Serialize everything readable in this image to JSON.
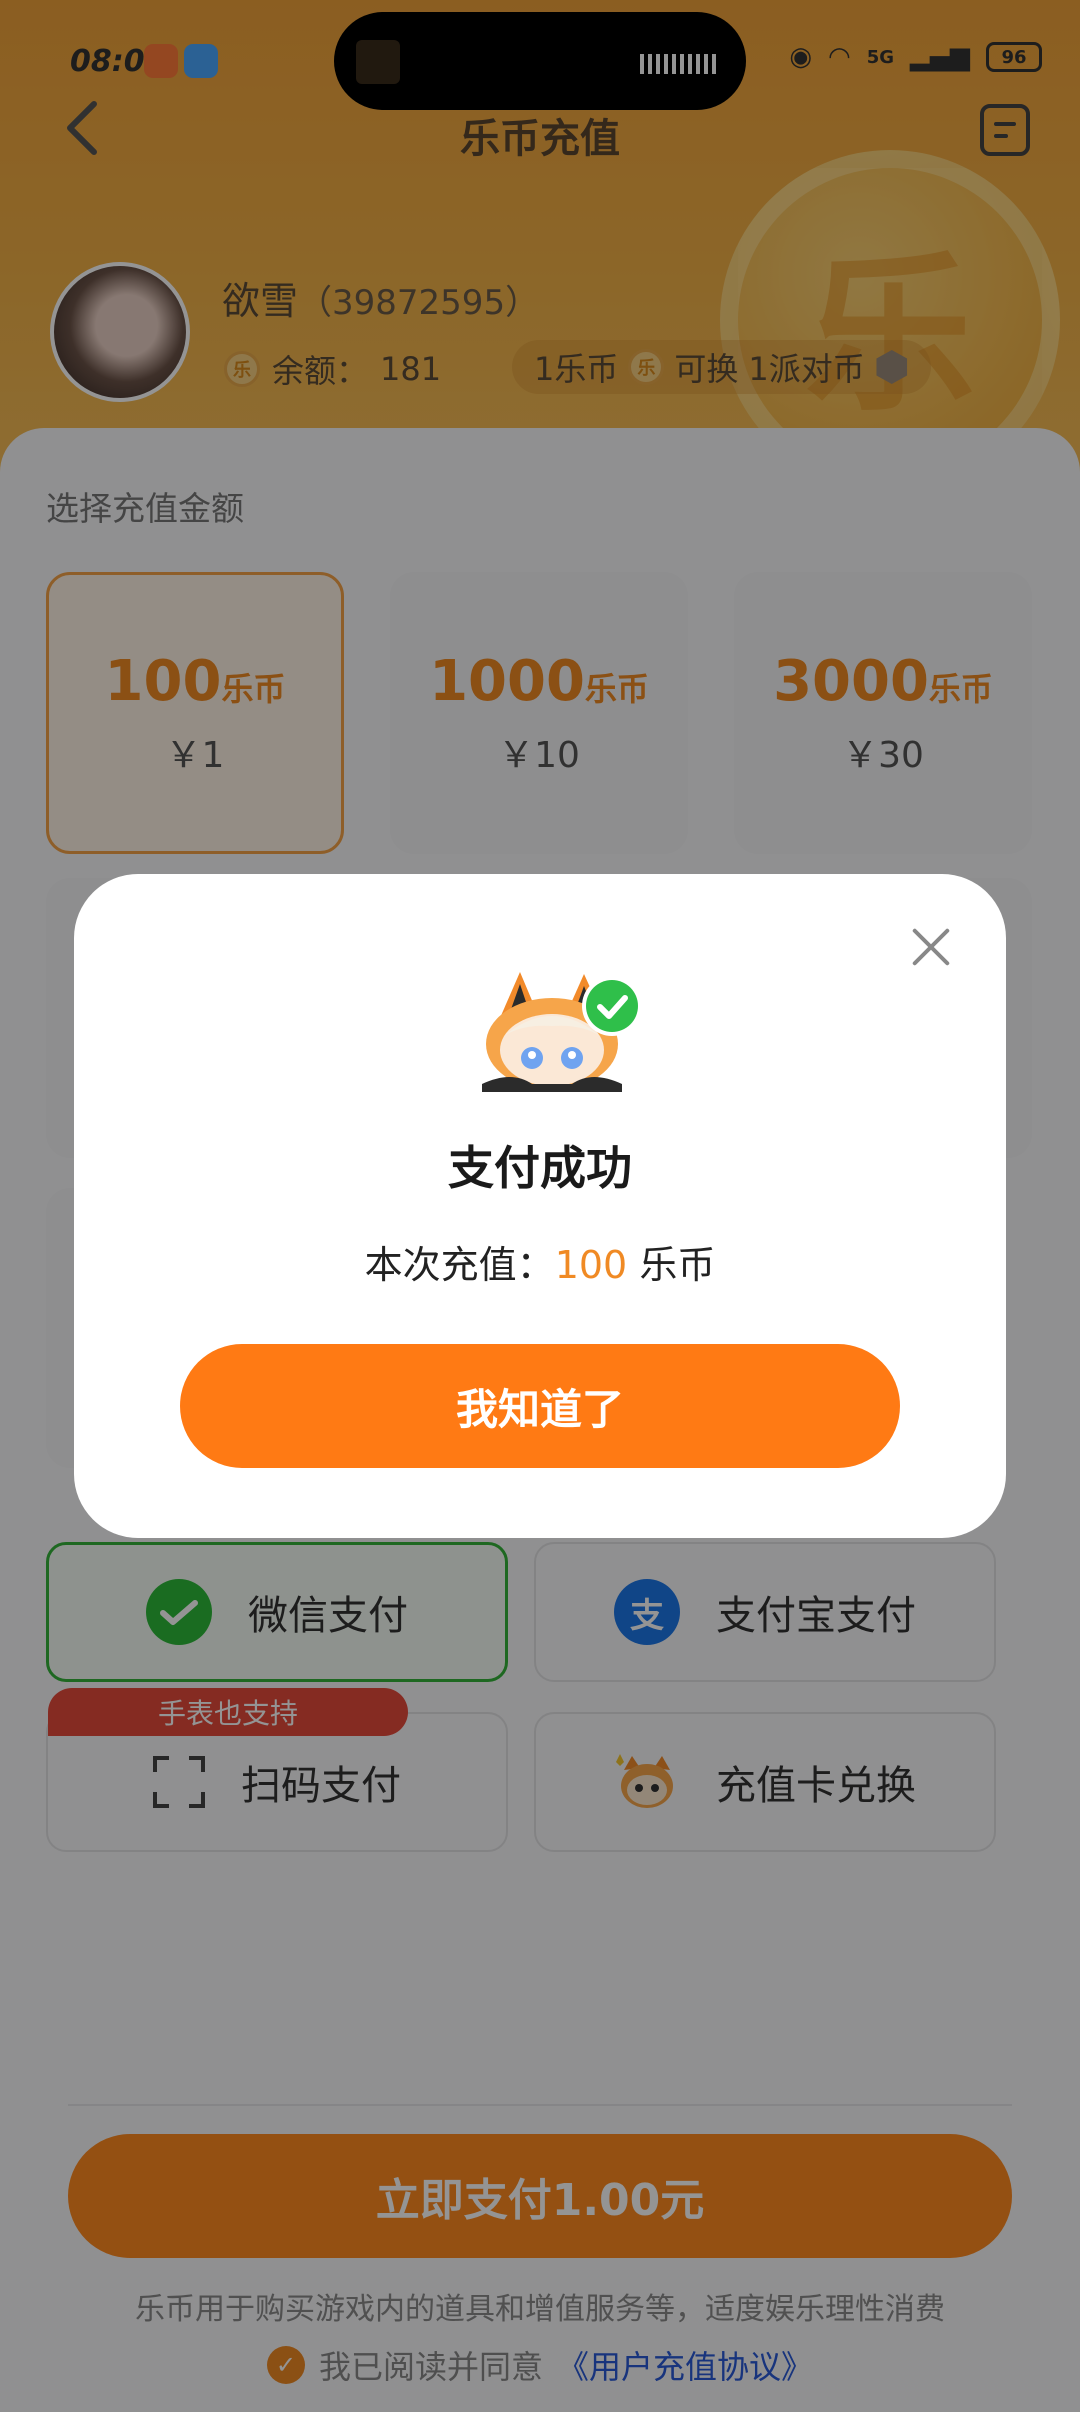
{
  "status_bar": {
    "time": "08:07",
    "network": "5G",
    "battery": "96"
  },
  "nav": {
    "title": "乐币充值"
  },
  "user": {
    "name": "欲雪",
    "id": "（39872595）",
    "balance_label": "余额：",
    "balance_value": "181",
    "rate_from": "1乐币",
    "rate_mid": "可换",
    "rate_to": "1派对币"
  },
  "coin_glyph": "乐",
  "recharge": {
    "section_label": "选择充值金额",
    "packages": [
      {
        "amount": "100",
        "unit": "乐币",
        "price": "￥1",
        "selected": true
      },
      {
        "amount": "1000",
        "unit": "乐币",
        "price": "￥10",
        "selected": false
      },
      {
        "amount": "3000",
        "unit": "乐币",
        "price": "￥30",
        "selected": false
      }
    ]
  },
  "payment": {
    "options": [
      {
        "label": "微信支付",
        "icon": "wechat-pay-icon",
        "selected": true
      },
      {
        "label": "支付宝支付",
        "icon": "alipay-icon",
        "icon_text": "支",
        "selected": false
      },
      {
        "label": "扫码支付",
        "icon": "scan-icon",
        "selected": false
      },
      {
        "label": "充值卡兑换",
        "icon": "mascot-card-icon",
        "selected": false
      }
    ],
    "watch_tag": "手表也支持"
  },
  "footer": {
    "pay_button": "立即支付1.00元",
    "note": "乐币用于购买游戏内的道具和增值服务等，适度娱乐理性消费",
    "agree_text": "我已阅读并同意",
    "agree_link": "《用户充值协议》"
  },
  "modal": {
    "title": "支付成功",
    "desc_prefix": "本次充值：",
    "amount": "100",
    "unit": "乐币",
    "button": "我知道了"
  },
  "colors": {
    "accent": "#ff7a14",
    "header": "#f2b046",
    "wechat": "#2dbb3a",
    "alipay": "#1d77e8",
    "success": "#2fbf4a"
  }
}
